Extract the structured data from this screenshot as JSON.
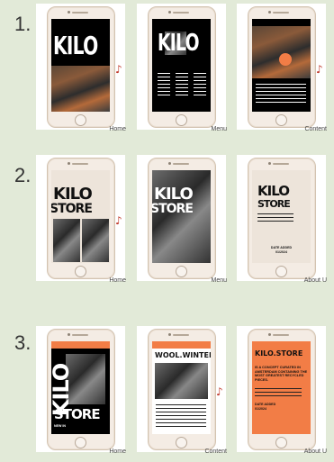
{
  "rows": [
    {
      "number": "1.",
      "cards": [
        {
          "caption": "Home",
          "title": "KILO"
        },
        {
          "caption": "Menu",
          "title": "KILO"
        },
        {
          "caption": "Content"
        }
      ]
    },
    {
      "number": "2.",
      "cards": [
        {
          "caption": "Home",
          "line1": "KILO",
          "line2": "STORE"
        },
        {
          "caption": "Menu",
          "line1": "KILO",
          "line2": "STORE"
        },
        {
          "caption": "About U",
          "line1": "KILO",
          "line2": "STORE",
          "date_label": "DATE ADDED",
          "date_value": "01/2024"
        }
      ]
    },
    {
      "number": "3.",
      "cards": [
        {
          "caption": "Home",
          "vertical_title": "KILO",
          "bottom_title": "STORE",
          "tag": "NEW IN"
        },
        {
          "caption": "Content",
          "title": "WOOL.WINTER"
        },
        {
          "caption": "About U",
          "title": "KILO.STORE",
          "body": "IS A CONCEPT CURATED IN AMSTERDAM CONTAINING THE MOST GREATEST RECYCLED PIECES.",
          "date_label": "DATE ADDED",
          "date_value": "01/2024"
        }
      ]
    }
  ],
  "colors": {
    "accent": "#f27d46",
    "screen_dark": "#000000",
    "screen_light": "#ede4da",
    "side_mark": "#c0392b",
    "background": "#e2ead8"
  },
  "side_mark_icon": "music-note-icon"
}
